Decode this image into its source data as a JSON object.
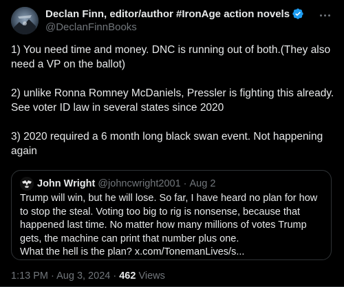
{
  "author": {
    "display_name": "Declan Finn, editor/author #IronAge action novels",
    "handle": "@DeclanFinnBooks",
    "verified": true
  },
  "tweet": {
    "paragraphs": [
      "1) You need time and money. DNC is running out of both.(They also need a VP on the ballot)",
      "2) unlike Ronna Romney McDaniels, Pressler is fighting this already. See voter ID law in several states since 2020",
      "3) 2020 required a 6 month long black swan event. Not happening again"
    ]
  },
  "quoted": {
    "name": "John Wright",
    "handle": "@johncwright2001",
    "separator": "·",
    "date": "Aug 2",
    "lines": [
      "Trump will win, but he will lose. So far, I have heard no plan for how",
      "to stop the steal. Voting too big to rig is nonsense, because that",
      "happened last time. No matter how many millions of votes Trump",
      "gets, the machine can print that number plus one.",
      "What the hell is the plan? x.com/TonemanLives/s..."
    ]
  },
  "meta": {
    "time": "1:13 PM",
    "separator": "·",
    "date": "Aug 3, 2024",
    "separator2": "·",
    "views_count": "462",
    "views_label": "Views"
  },
  "icons": {
    "verified": "verified-badge-icon",
    "more": "more-options-icon"
  },
  "colors": {
    "background": "#000000",
    "text": "#e7e9ea",
    "secondary": "#71767b",
    "border": "#2f3336",
    "verified_blue": "#1d9bf0"
  }
}
